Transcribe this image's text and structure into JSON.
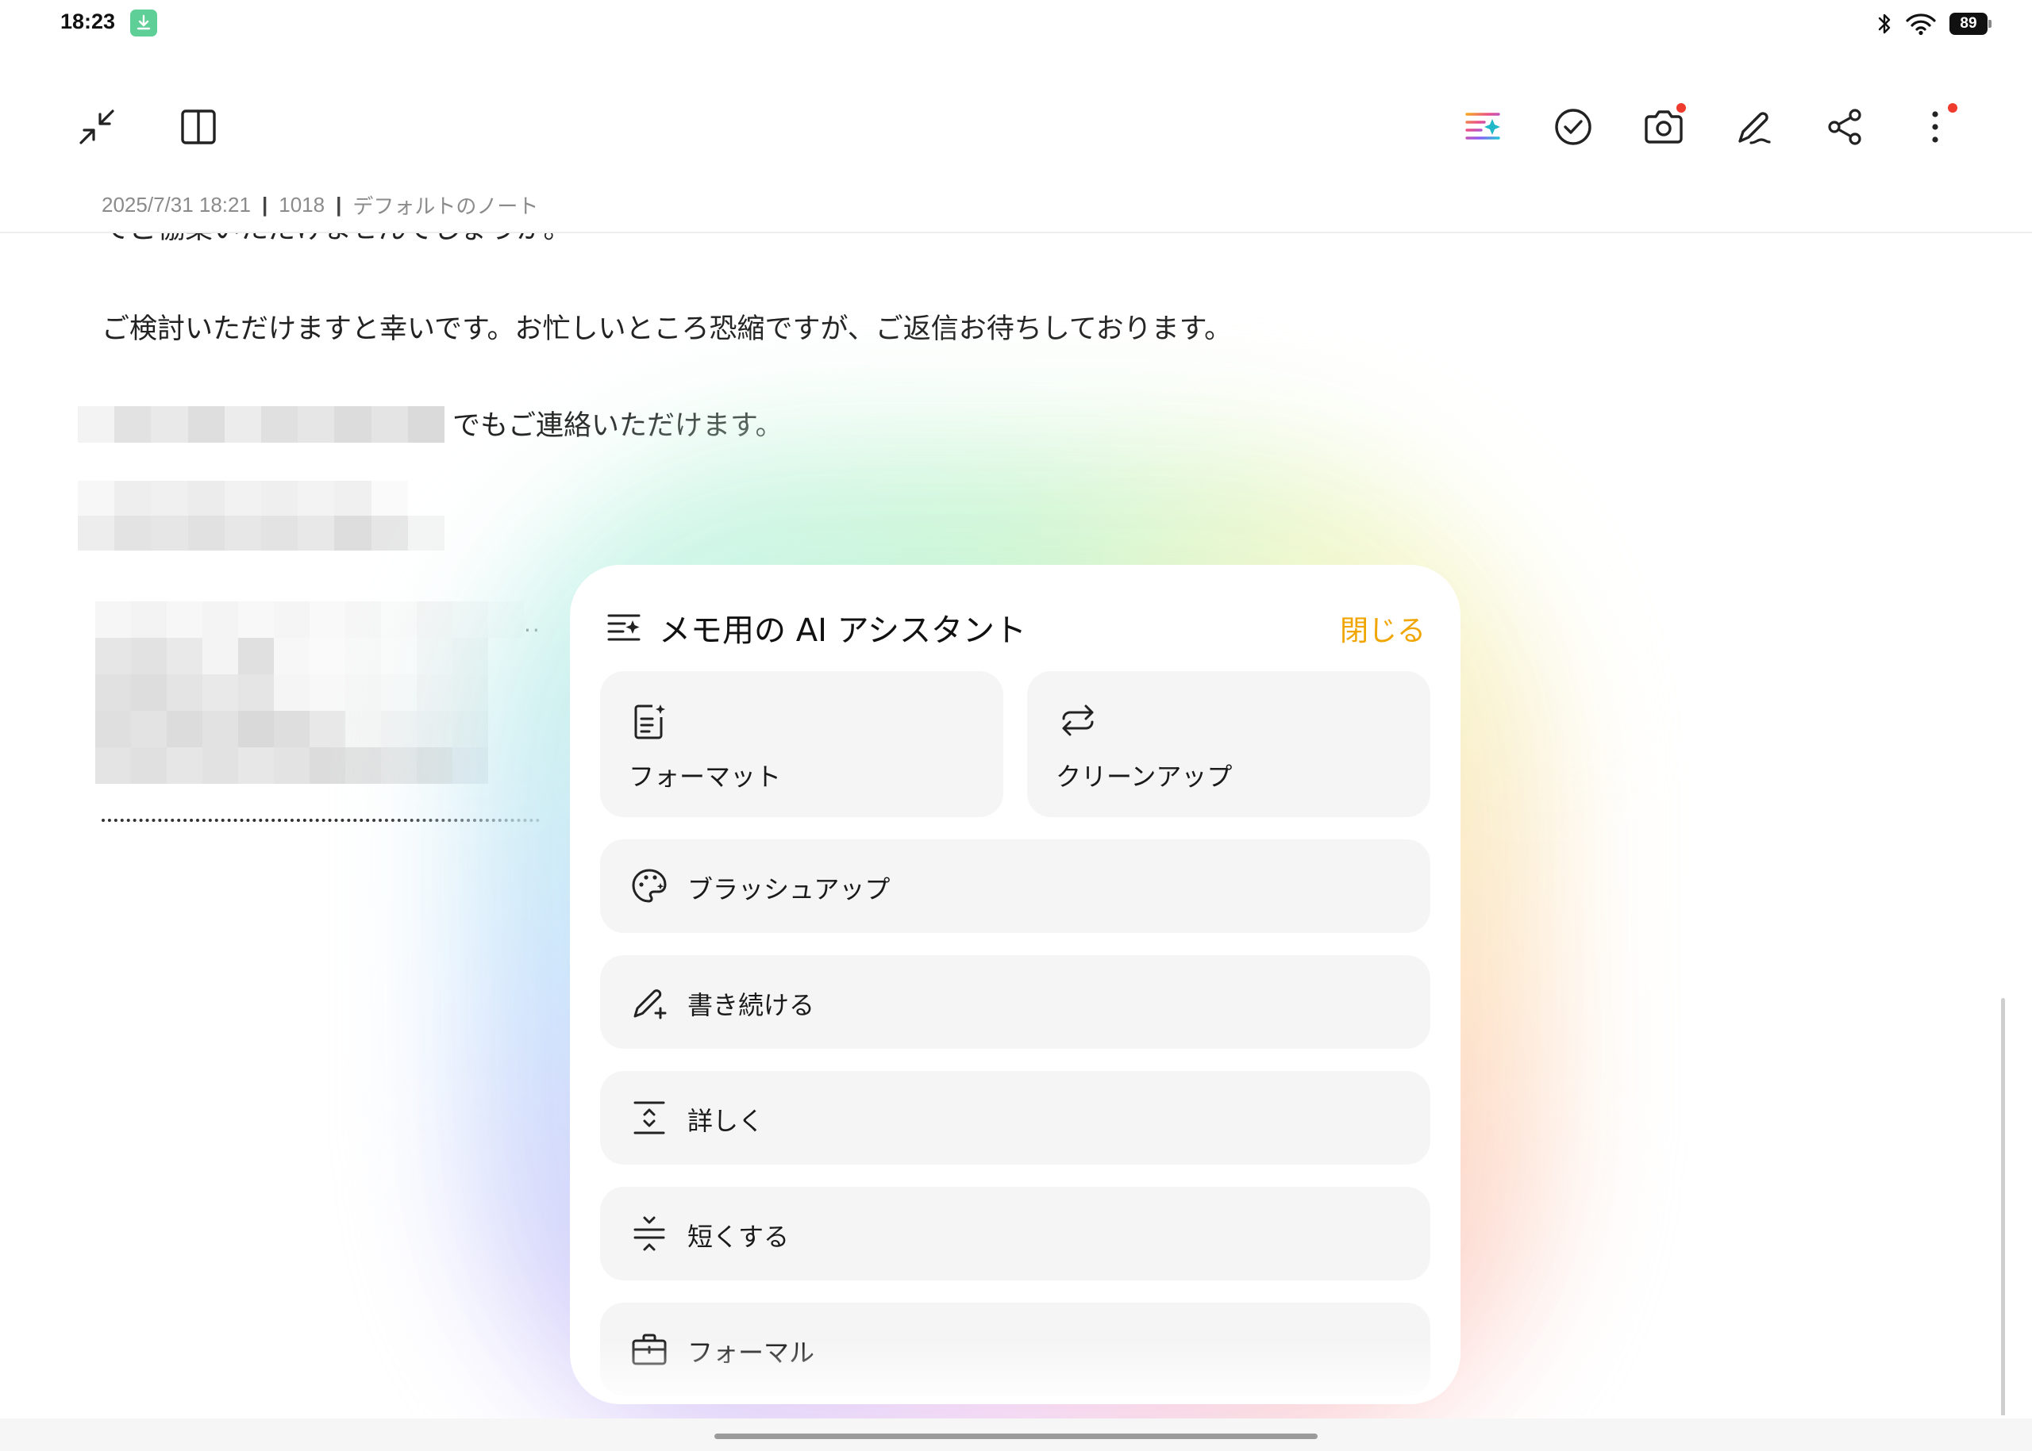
{
  "status_bar": {
    "time": "18:23",
    "battery": "89"
  },
  "toolbar": {
    "left": [
      "collapse-icon",
      "split-view-icon"
    ],
    "right": [
      "ai-assistant-icon",
      "checklist-icon",
      "camera-icon",
      "pen-icon",
      "share-icon",
      "more-icon"
    ]
  },
  "meta": {
    "datetime": "2025/7/31 18:21",
    "chars": "1018",
    "notebook": "デフォルトのノート",
    "separator": "|"
  },
  "note": {
    "partial_line": "てご協業いただけませんでしょうか。",
    "line1": "ご検討いただけますと幸いです。お忙しいところ恐縮ですが、ご返信お待ちしております。",
    "line2": "でもご連絡いただけます。",
    "small_dots": "..",
    "dotted_rule": "......................................................."
  },
  "ai_panel": {
    "title": "メモ用の AI アシスタント",
    "close": "閉じる",
    "close_color": "#f0a500",
    "tiles": [
      {
        "label": "フォーマット",
        "icon": "format-icon"
      },
      {
        "label": "クリーンアップ",
        "icon": "cleanup-icon"
      }
    ],
    "rows": [
      {
        "label": "ブラッシュアップ",
        "icon": "palette-icon"
      },
      {
        "label": "書き続ける",
        "icon": "continue-writing-icon"
      },
      {
        "label": "詳しく",
        "icon": "expand-icon"
      },
      {
        "label": "短くする",
        "icon": "shorten-icon"
      },
      {
        "label": "フォーマル",
        "icon": "briefcase-icon"
      }
    ]
  },
  "colors": {
    "accent": "#f0a500",
    "notification_dot": "#ee3b2d",
    "download_badge": "#5fcf98"
  }
}
